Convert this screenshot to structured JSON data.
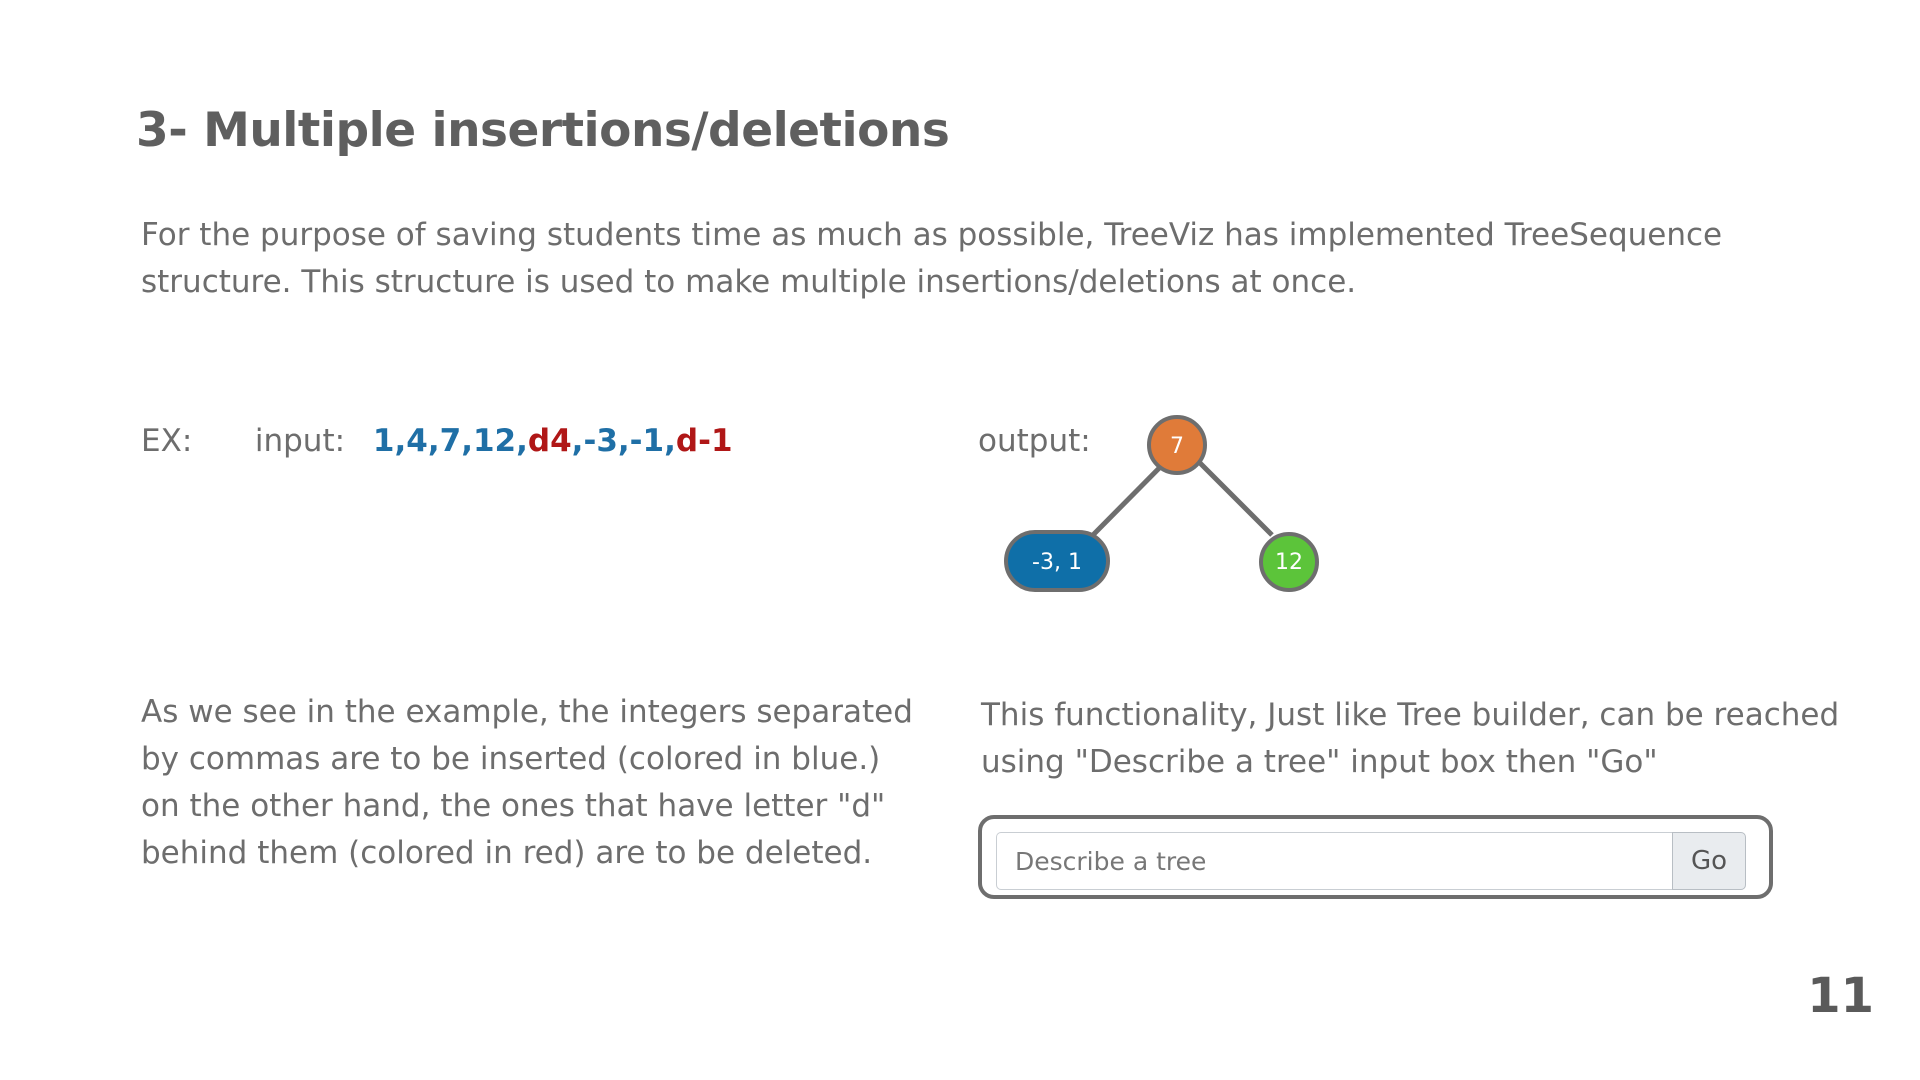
{
  "slide": {
    "title": "3- Multiple insertions/deletions",
    "intro": "For the purpose of saving students time as much as possible, TreeViz has implemented TreeSequence structure. This structure is used to make multiple insertions/deletions at once.",
    "page_number": "11"
  },
  "example": {
    "ex_label": "EX:",
    "input_label": "input:",
    "tokens": [
      {
        "text": "1,",
        "kind": "insert"
      },
      {
        "text": "4,",
        "kind": "insert"
      },
      {
        "text": "7,",
        "kind": "insert"
      },
      {
        "text": "12,",
        "kind": "insert"
      },
      {
        "text": "d4",
        "kind": "delete"
      },
      {
        "text": ",",
        "kind": "insert"
      },
      {
        "text": "-3,",
        "kind": "insert"
      },
      {
        "text": "-1,",
        "kind": "insert"
      },
      {
        "text": "d-1",
        "kind": "delete"
      }
    ],
    "colors": {
      "insert": "#1f6fa6",
      "delete": "#b01717"
    },
    "output_label": "output:",
    "tree": {
      "root": {
        "label": "7",
        "color": "#e07b39"
      },
      "left": {
        "label": "-3, 1",
        "color": "#0f6fa8"
      },
      "right": {
        "label": "12",
        "color": "#5cc43a"
      },
      "edge_color": "#6e6e6e"
    }
  },
  "explanation": "As we see in the example, the integers separated by commas are to be inserted (colored in blue.) on the other hand, the ones that have letter \"d\" behind them (colored in red) are to be deleted.",
  "reach_note": "This functionality, Just like Tree builder, can be reached using \"Describe a tree\" input box then \"Go\"",
  "describe_box": {
    "placeholder": "Describe a tree",
    "button_label": "Go"
  }
}
